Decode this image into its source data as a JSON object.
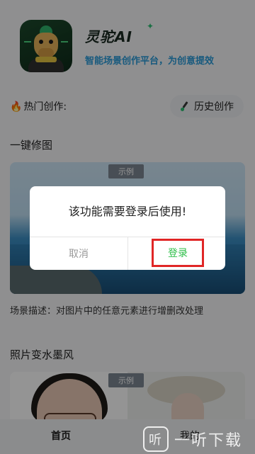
{
  "header": {
    "app_title": "灵驼AI",
    "subtitle": "智能场景创作平台，为创意提效"
  },
  "hot": {
    "label": "热门创作:",
    "history_label": "历史创作"
  },
  "sections": [
    {
      "title": "一键修图",
      "badge": "示例",
      "description": "场景描述：对图片中的任意元素进行增删改处理"
    },
    {
      "title": "照片变水墨风",
      "badge": "示例"
    }
  ],
  "dialog": {
    "message": "该功能需要登录后使用!",
    "cancel_label": "取消",
    "login_label": "登录"
  },
  "bottom_nav": {
    "home_label": "首页",
    "mine_label": "我的"
  },
  "watermark": {
    "text": "一听下载",
    "icon_glyph": "听"
  },
  "colors": {
    "login_text": "#2fbf4a",
    "highlight_border": "#e02626",
    "subtitle": "#2a9bd9",
    "badge_bg": "#7d8793"
  }
}
